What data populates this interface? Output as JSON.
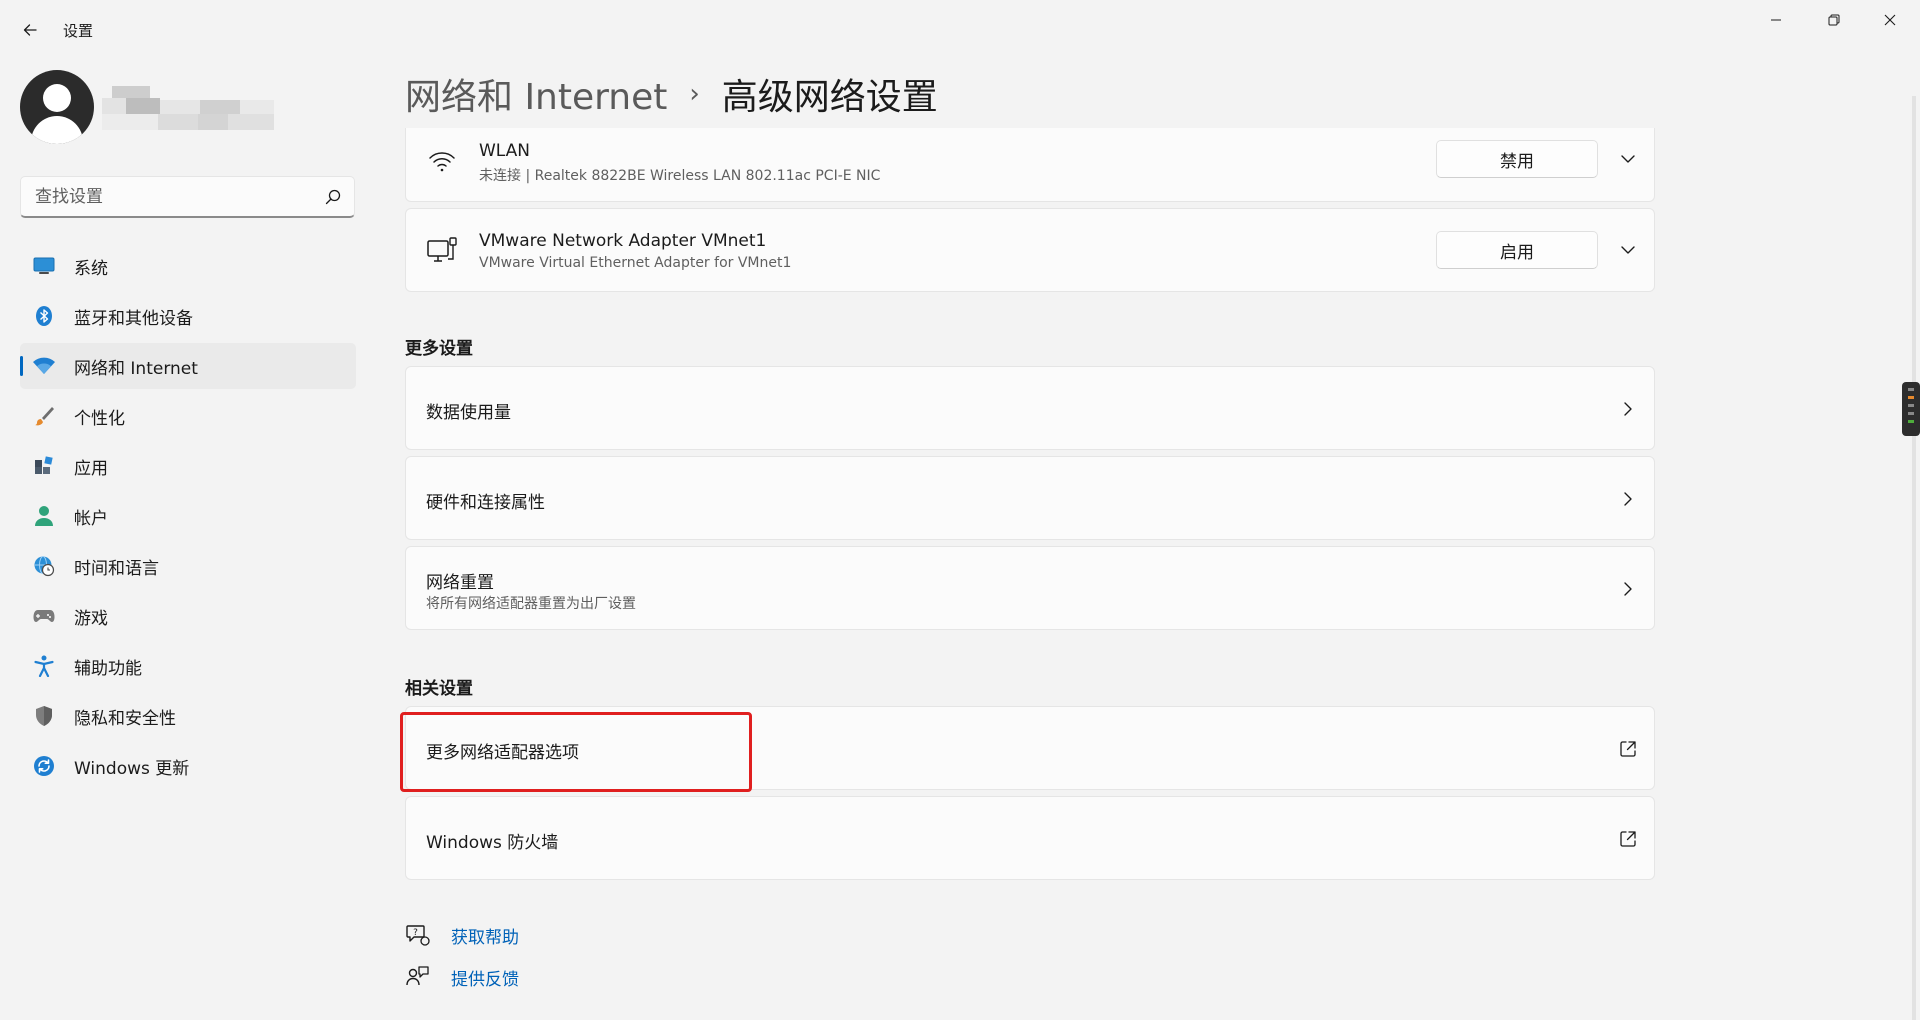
{
  "window": {
    "title": "设置"
  },
  "search": {
    "placeholder": "查找设置"
  },
  "sidebar": {
    "items": [
      {
        "label": "系统",
        "icon": "system-icon"
      },
      {
        "label": "蓝牙和其他设备",
        "icon": "bluetooth-icon"
      },
      {
        "label": "网络和 Internet",
        "icon": "wifi-icon",
        "active": true
      },
      {
        "label": "个性化",
        "icon": "brush-icon"
      },
      {
        "label": "应用",
        "icon": "apps-icon"
      },
      {
        "label": "帐户",
        "icon": "account-icon"
      },
      {
        "label": "时间和语言",
        "icon": "globe-clock-icon"
      },
      {
        "label": "游戏",
        "icon": "gamepad-icon"
      },
      {
        "label": "辅助功能",
        "icon": "accessibility-icon"
      },
      {
        "label": "隐私和安全性",
        "icon": "shield-icon"
      },
      {
        "label": "Windows 更新",
        "icon": "update-icon"
      }
    ]
  },
  "breadcrumb": {
    "parent": "网络和 Internet",
    "separator": "›",
    "current": "高级网络设置"
  },
  "adapters": [
    {
      "name": "WLAN",
      "description": "未连接 | Realtek 8822BE Wireless LAN 802.11ac PCI-E NIC",
      "action": "禁用",
      "icon": "wifi-icon"
    },
    {
      "name": "VMware Network Adapter VMnet1",
      "description": "VMware Virtual Ethernet Adapter for VMnet1",
      "action": "启用",
      "icon": "ethernet-adapter-icon"
    }
  ],
  "more_settings": {
    "header": "更多设置",
    "items": [
      {
        "title": "数据使用量",
        "subtitle": ""
      },
      {
        "title": "硬件和连接属性",
        "subtitle": ""
      },
      {
        "title": "网络重置",
        "subtitle": "将所有网络适配器重置为出厂设置"
      }
    ]
  },
  "related_settings": {
    "header": "相关设置",
    "items": [
      {
        "title": "更多网络适配器选项",
        "icon": "external-link-icon"
      },
      {
        "title": "Windows 防火墙",
        "icon": "external-link-icon"
      }
    ]
  },
  "help": {
    "get_help": "获取帮助",
    "feedback": "提供反馈"
  },
  "colors": {
    "accent": "#0067c0",
    "link": "#0062b8",
    "highlight": "#e01f1f",
    "background": "#f3f3f3",
    "card": "#fbfbfb"
  }
}
